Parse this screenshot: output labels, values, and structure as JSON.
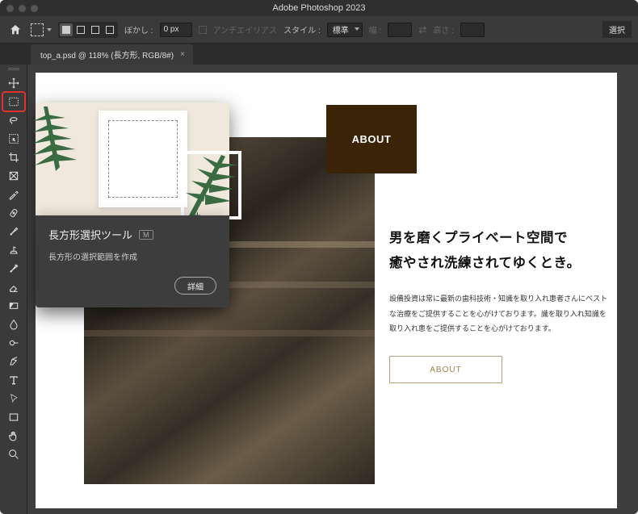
{
  "app": {
    "title": "Adobe Photoshop 2023"
  },
  "document": {
    "tab_title": "top_a.psd @ 118% (長方形, RGB/8#)"
  },
  "options_bar": {
    "feather_label": "ぼかし :",
    "feather_value": "0 px",
    "antialias_label": "アンチエイリアス",
    "style_label": "スタイル :",
    "style_value": "標準",
    "width_label": "幅 :",
    "height_label": "高さ :",
    "select_button": "選択"
  },
  "tooltip": {
    "tool_name": "長方形選択ツール",
    "shortcut": "M",
    "description": "長方形の選択範囲を作成",
    "detail_button": "詳細"
  },
  "content": {
    "badge": "ABOUT",
    "heading_line1": "男を磨くプライベート空間で",
    "heading_line2": "癒やされ洗練されてゆくとき。",
    "body": "設備投資は常に最新の歯科技術・知識を取り入れ患者さんにベストな治療をご提供することを心がけております。識を取り入れ知識を取り入れ患をご提供することを心がけております。",
    "button": "ABOUT"
  },
  "tools": [
    {
      "name": "move-tool"
    },
    {
      "name": "rectangular-marquee-tool"
    },
    {
      "name": "lasso-tool"
    },
    {
      "name": "object-selection-tool"
    },
    {
      "name": "crop-tool"
    },
    {
      "name": "frame-tool"
    },
    {
      "name": "eyedropper-tool"
    },
    {
      "name": "spot-healing-tool"
    },
    {
      "name": "brush-tool"
    },
    {
      "name": "clone-stamp-tool"
    },
    {
      "name": "history-brush-tool"
    },
    {
      "name": "eraser-tool"
    },
    {
      "name": "gradient-tool"
    },
    {
      "name": "blur-tool"
    },
    {
      "name": "dodge-tool"
    },
    {
      "name": "pen-tool"
    },
    {
      "name": "type-tool"
    },
    {
      "name": "path-selection-tool"
    },
    {
      "name": "rectangle-shape-tool"
    },
    {
      "name": "hand-tool"
    },
    {
      "name": "zoom-tool"
    }
  ]
}
